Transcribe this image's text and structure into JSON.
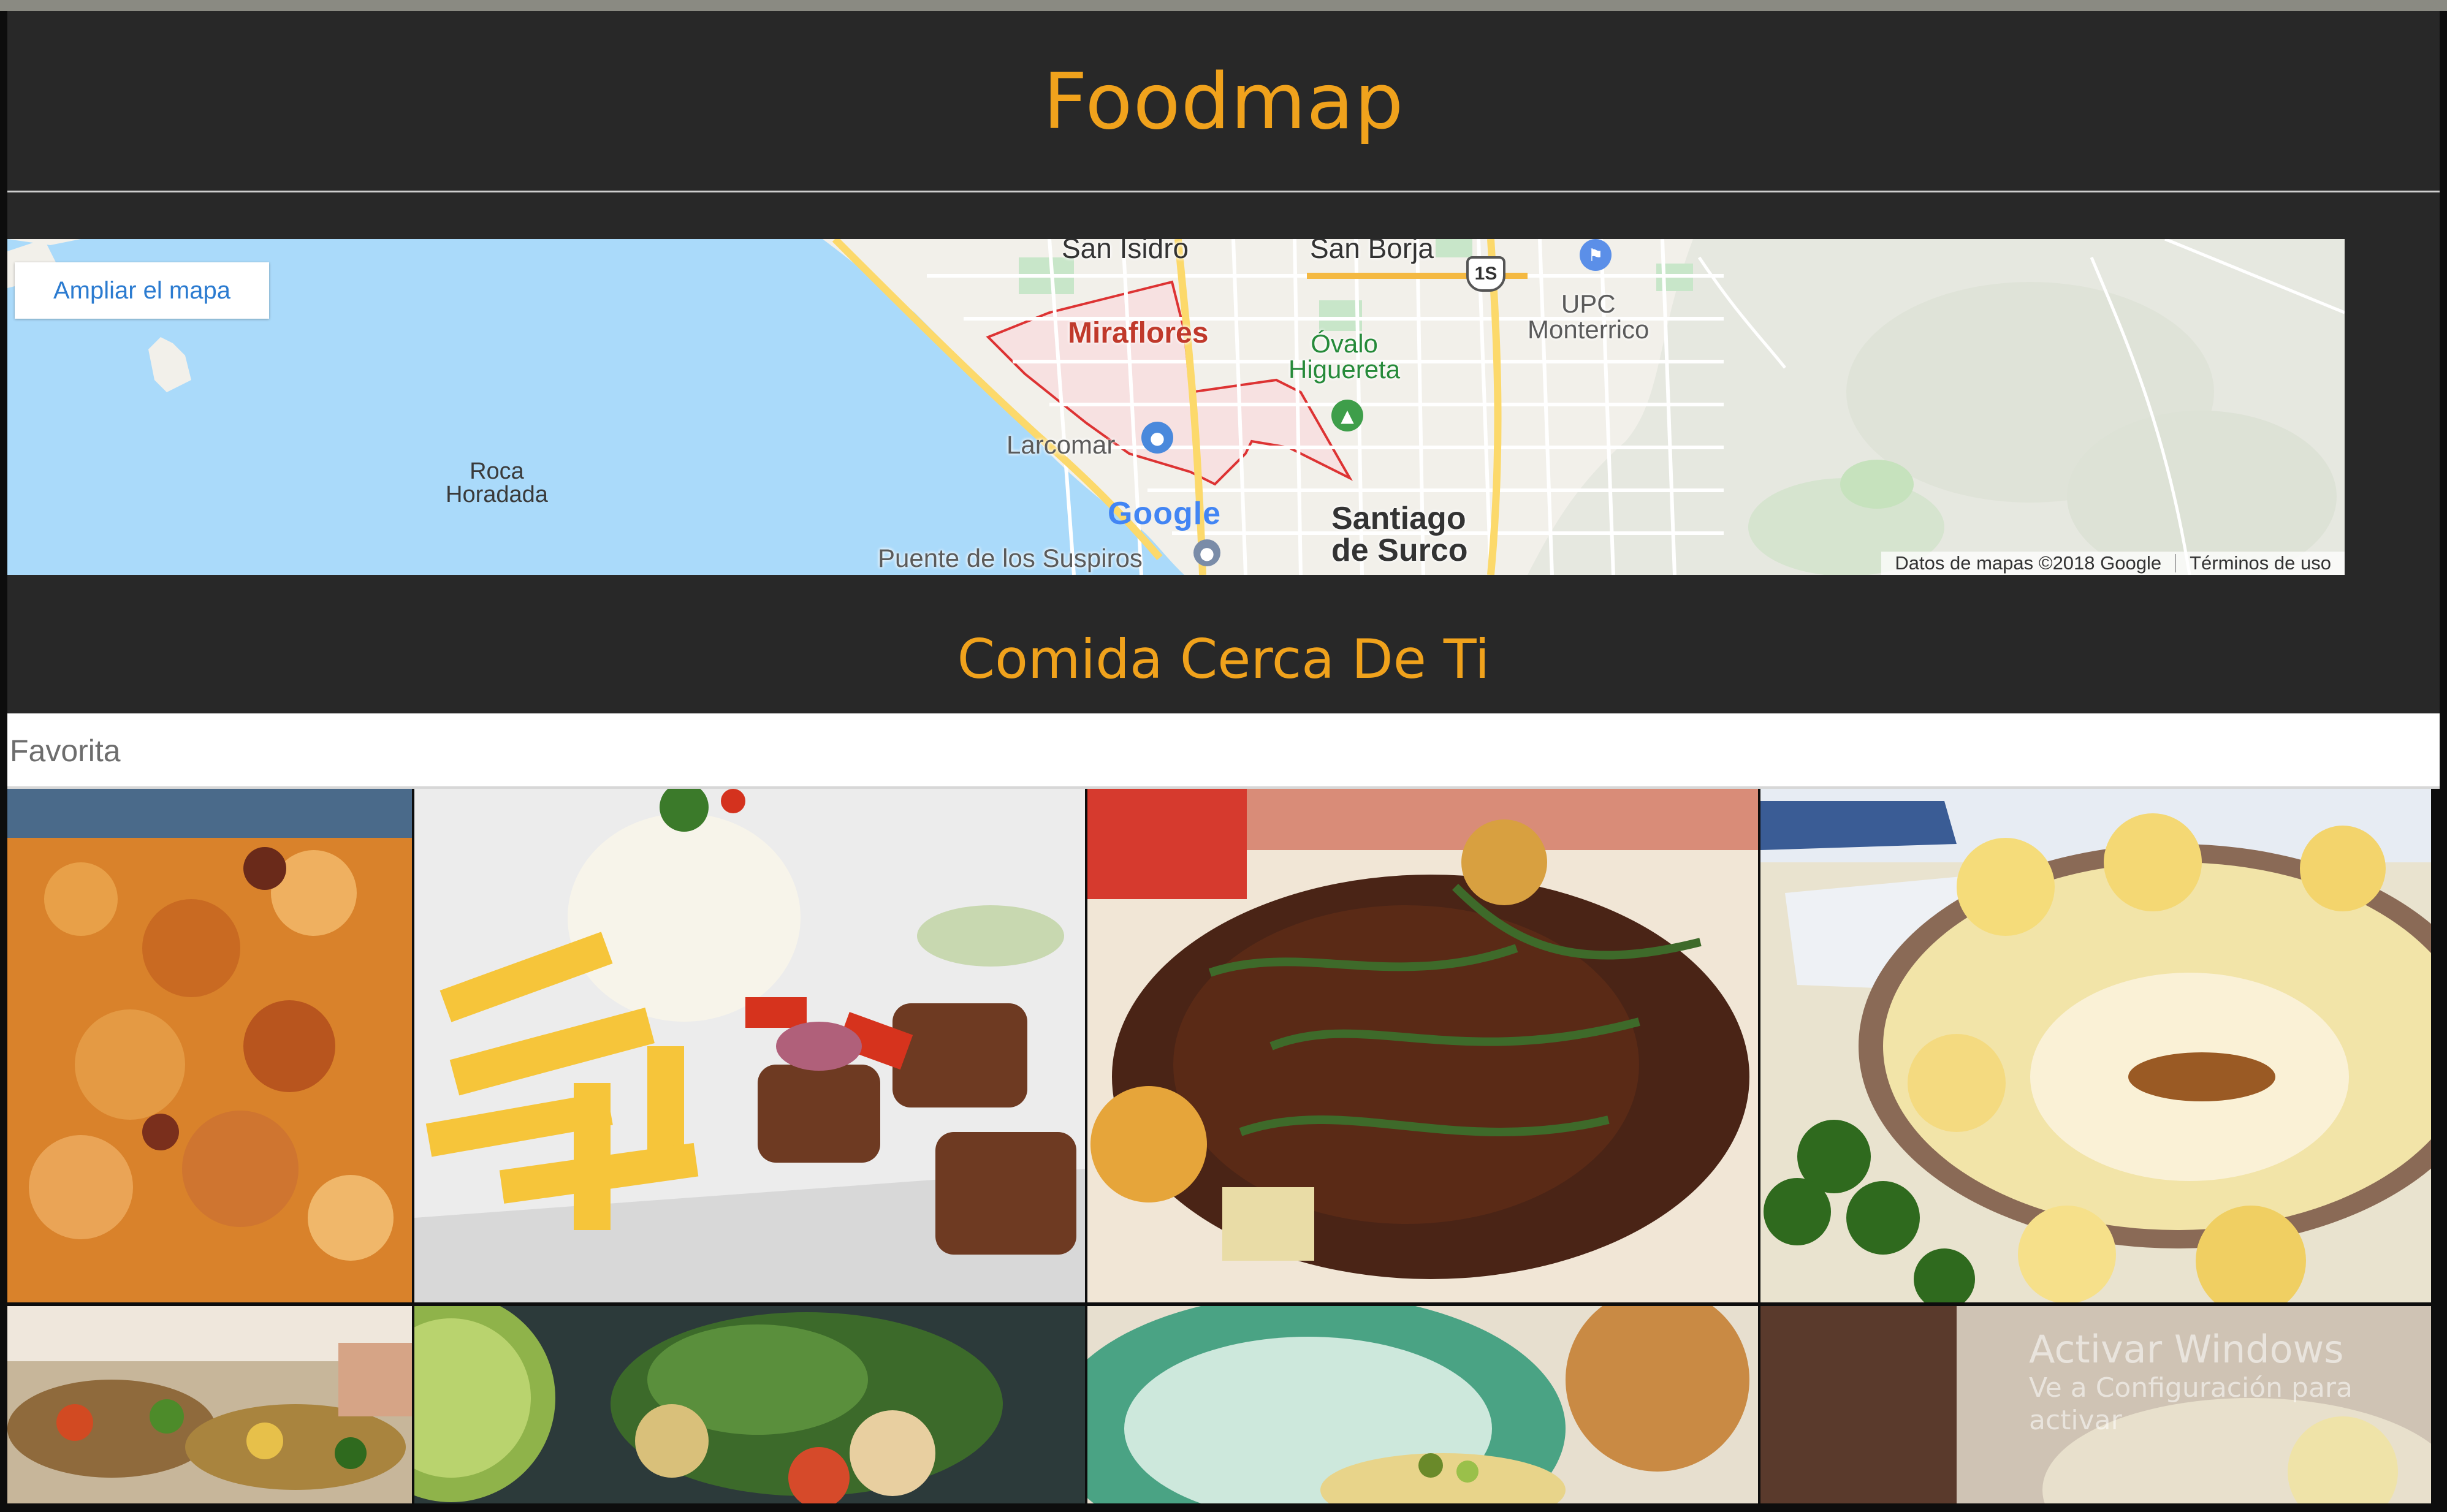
{
  "app": {
    "title": "Foodmap"
  },
  "map": {
    "enlarge_label": "Ampliar el mapa",
    "labels": {
      "san_isidro": "San Isidro",
      "san_borja": "San Borja",
      "upc": "UPC\nMonterrico",
      "miraflores": "Miraflores",
      "ovalo": "Óvalo\nHiguereta",
      "larcomar": "Larcomar",
      "roca": "Roca\nHoradada",
      "santiago": "Santiago\nde Surco",
      "puente": "Puente de los Suspiros",
      "highway": "1S"
    },
    "google_logo": "Google",
    "attribution": "Datos de mapas ©2018 Google",
    "terms": "Términos de uso"
  },
  "section": {
    "title": "Comida Cerca De Ti"
  },
  "filter": {
    "favorite_label": "Favorita"
  },
  "watermark": {
    "line1": "Activar Windows",
    "line2": "Ve a Configuración para activar"
  },
  "colors": {
    "accent": "#F0A21C",
    "header_bg": "#282828",
    "sea": "#aadafa",
    "map_link": "#2b7bd0"
  }
}
